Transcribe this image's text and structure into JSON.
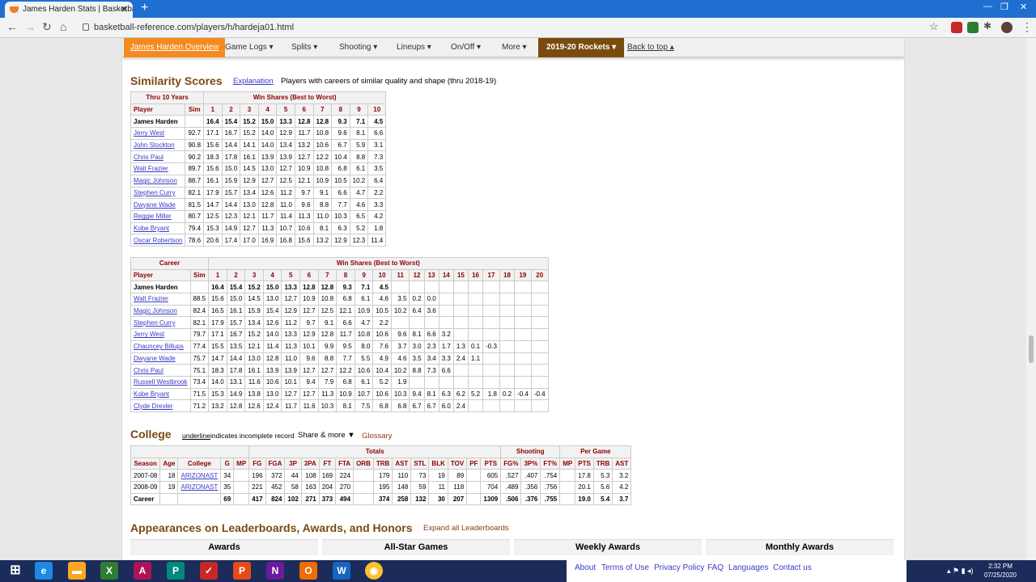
{
  "browser": {
    "tab_title": "James Harden Stats | Basketball-R",
    "url": "basketball-reference.com/players/h/hardeja01.html"
  },
  "navbar": {
    "items": [
      "James Harden Overview",
      "Game Logs ▾",
      "Splits ▾",
      "Shooting ▾",
      "Lineups ▾",
      "On/Off ▾",
      "More ▾",
      "2019-20 Rockets ▾",
      "Back to top ▴"
    ]
  },
  "similarity": {
    "title": "Similarity Scores",
    "explanation": "Explanation",
    "note": "Players with careers of similar quality and shape (thru 2018-19)"
  },
  "thru10": {
    "group1": "Thru 10 Years",
    "group2": "Win Shares (Best to Worst)",
    "headers": [
      "Player",
      "Sim",
      "1",
      "2",
      "3",
      "4",
      "5",
      "6",
      "7",
      "8",
      "9",
      "10"
    ],
    "rows": [
      [
        "James Harden",
        "",
        "16.4",
        "15.4",
        "15.2",
        "15.0",
        "13.3",
        "12.8",
        "12.8",
        "9.3",
        "7.1",
        "4.5"
      ],
      [
        "Jerry West",
        "92.7",
        "17.1",
        "16.7",
        "15.2",
        "14.0",
        "12.9",
        "11.7",
        "10.8",
        "9.6",
        "8.1",
        "6.6"
      ],
      [
        "John Stockton",
        "90.8",
        "15.6",
        "14.4",
        "14.1",
        "14.0",
        "13.4",
        "13.2",
        "10.6",
        "6.7",
        "5.9",
        "3.1"
      ],
      [
        "Chris Paul",
        "90.2",
        "18.3",
        "17.8",
        "16.1",
        "13.9",
        "13.9",
        "12.7",
        "12.2",
        "10.4",
        "8.8",
        "7.3"
      ],
      [
        "Walt Frazier",
        "89.7",
        "15.6",
        "15.0",
        "14.5",
        "13.0",
        "12.7",
        "10.9",
        "10.8",
        "6.8",
        "6.1",
        "3.5"
      ],
      [
        "Magic Johnson",
        "88.7",
        "16.1",
        "15.9",
        "12.9",
        "12.7",
        "12.5",
        "12.1",
        "10.9",
        "10.5",
        "10.2",
        "6.4"
      ],
      [
        "Stephen Curry",
        "82.1",
        "17.9",
        "15.7",
        "13.4",
        "12.6",
        "11.2",
        "9.7",
        "9.1",
        "6.6",
        "4.7",
        "2.2"
      ],
      [
        "Dwyane Wade",
        "81.5",
        "14.7",
        "14.4",
        "13.0",
        "12.8",
        "11.0",
        "9.6",
        "8.8",
        "7.7",
        "4.6",
        "3.3"
      ],
      [
        "Reggie Miller",
        "80.7",
        "12.5",
        "12.3",
        "12.1",
        "11.7",
        "11.4",
        "11.3",
        "11.0",
        "10.3",
        "6.5",
        "4.2"
      ],
      [
        "Kobe Bryant",
        "79.4",
        "15.3",
        "14.9",
        "12.7",
        "11.3",
        "10.7",
        "10.6",
        "8.1",
        "6.3",
        "5.2",
        "1.8"
      ],
      [
        "Oscar Robertson",
        "78.6",
        "20.6",
        "17.4",
        "17.0",
        "16.9",
        "16.8",
        "15.6",
        "13.2",
        "12.9",
        "12.3",
        "11.4"
      ]
    ]
  },
  "career": {
    "group1": "Career",
    "group2": "Win Shares (Best to Worst)",
    "headers": [
      "Player",
      "Sim",
      "1",
      "2",
      "3",
      "4",
      "5",
      "6",
      "7",
      "8",
      "9",
      "10",
      "11",
      "12",
      "13",
      "14",
      "15",
      "16",
      "17",
      "18",
      "19",
      "20"
    ],
    "rows": [
      [
        "James Harden",
        "",
        "16.4",
        "15.4",
        "15.2",
        "15.0",
        "13.3",
        "12.8",
        "12.8",
        "9.3",
        "7.1",
        "4.5",
        "",
        "",
        "",
        "",
        "",
        "",
        "",
        "",
        "",
        ""
      ],
      [
        "Walt Frazier",
        "88.5",
        "15.6",
        "15.0",
        "14.5",
        "13.0",
        "12.7",
        "10.9",
        "10.8",
        "6.8",
        "6.1",
        "4.6",
        "3.5",
        "0.2",
        "0.0",
        "",
        "",
        "",
        "",
        "",
        "",
        ""
      ],
      [
        "Magic Johnson",
        "82.4",
        "16.5",
        "16.1",
        "15.9",
        "15.4",
        "12.9",
        "12.7",
        "12.5",
        "12.1",
        "10.9",
        "10.5",
        "10.2",
        "6.4",
        "3.6",
        "",
        "",
        "",
        "",
        "",
        "",
        ""
      ],
      [
        "Stephen Curry",
        "82.1",
        "17.9",
        "15.7",
        "13.4",
        "12.6",
        "11.2",
        "9.7",
        "9.1",
        "6.6",
        "4.7",
        "2.2",
        "",
        "",
        "",
        "",
        "",
        "",
        "",
        "",
        "",
        ""
      ],
      [
        "Jerry West",
        "79.7",
        "17.1",
        "16.7",
        "15.2",
        "14.0",
        "13.3",
        "12.9",
        "12.8",
        "11.7",
        "10.8",
        "10.6",
        "9.6",
        "8.1",
        "6.6",
        "3.2",
        "",
        "",
        "",
        "",
        "",
        ""
      ],
      [
        "Chauncey Billups",
        "77.4",
        "15.5",
        "13.5",
        "12.1",
        "11.4",
        "11.3",
        "10.1",
        "9.9",
        "9.5",
        "8.0",
        "7.6",
        "3.7",
        "3.0",
        "2.3",
        "1.7",
        "1.3",
        "0.1",
        "-0.3",
        "",
        "",
        ""
      ],
      [
        "Dwyane Wade",
        "75.7",
        "14.7",
        "14.4",
        "13.0",
        "12.8",
        "11.0",
        "9.6",
        "8.8",
        "7.7",
        "5.5",
        "4.9",
        "4.6",
        "3.5",
        "3.4",
        "3.3",
        "2.4",
        "1.1",
        "",
        "",
        "",
        ""
      ],
      [
        "Chris Paul",
        "75.1",
        "18.3",
        "17.8",
        "16.1",
        "13.9",
        "13.9",
        "12.7",
        "12.7",
        "12.2",
        "10.6",
        "10.4",
        "10.2",
        "8.8",
        "7.3",
        "6.6",
        "",
        "",
        "",
        "",
        "",
        ""
      ],
      [
        "Russell Westbrook",
        "73.4",
        "14.0",
        "13.1",
        "11.6",
        "10.6",
        "10.1",
        "9.4",
        "7.9",
        "6.8",
        "6.1",
        "5.2",
        "1.9",
        "",
        "",
        "",
        "",
        "",
        "",
        "",
        "",
        ""
      ],
      [
        "Kobe Bryant",
        "71.5",
        "15.3",
        "14.9",
        "13.8",
        "13.0",
        "12.7",
        "12.7",
        "11.3",
        "10.9",
        "10.7",
        "10.6",
        "10.3",
        "9.4",
        "8.1",
        "6.3",
        "6.2",
        "5.2",
        "1.8",
        "0.2",
        "-0.4",
        "-0.4"
      ],
      [
        "Clyde Drexler",
        "71.2",
        "13.2",
        "12.8",
        "12.6",
        "12.4",
        "11.7",
        "11.6",
        "10.3",
        "8.1",
        "7.5",
        "6.8",
        "6.8",
        "6.7",
        "6.7",
        "6.0",
        "2.4",
        "",
        "",
        "",
        "",
        ""
      ]
    ]
  },
  "college": {
    "title": "College",
    "underline": "underline",
    "underline_note": "indicates incomplete record",
    "share": "Share & more ▼",
    "glossary": "Glossary",
    "groups": [
      "Totals",
      "Shooting",
      "Per Game"
    ],
    "headers": [
      "Season",
      "Age",
      "College",
      "G",
      "MP",
      "FG",
      "FGA",
      "3P",
      "3PA",
      "FT",
      "FTA",
      "ORB",
      "TRB",
      "AST",
      "STL",
      "BLK",
      "TOV",
      "PF",
      "PTS",
      "FG%",
      "3P%",
      "FT%",
      "MP",
      "PTS",
      "TRB",
      "AST"
    ],
    "rows": [
      [
        "2007-08",
        "18",
        "ARIZONAST",
        "34",
        "",
        "196",
        "372",
        "44",
        "108",
        "169",
        "224",
        "",
        "179",
        "110",
        "73",
        "19",
        "89",
        "",
        "605",
        ".527",
        ".407",
        ".754",
        "",
        "17.8",
        "5.3",
        "3.2"
      ],
      [
        "2008-09",
        "19",
        "ARIZONAST",
        "35",
        "",
        "221",
        "452",
        "58",
        "163",
        "204",
        "270",
        "",
        "195",
        "148",
        "59",
        "11",
        "118",
        "",
        "704",
        ".489",
        ".356",
        ".756",
        "",
        "20.1",
        "5.6",
        "4.2"
      ],
      [
        "Career",
        "",
        "",
        "69",
        "",
        "417",
        "824",
        "102",
        "271",
        "373",
        "494",
        "",
        "374",
        "258",
        "132",
        "30",
        "207",
        "",
        "1309",
        ".506",
        ".376",
        ".755",
        "",
        "19.0",
        "5.4",
        "3.7"
      ]
    ]
  },
  "appearances": {
    "title": "Appearances on Leaderboards, Awards, and Honors",
    "expand": "Expand all Leaderboards"
  },
  "awards": [
    "Awards",
    "All-Star Games",
    "Weekly Awards",
    "Monthly Awards"
  ],
  "footer": [
    "About",
    "Terms of Use",
    "Privacy Policy",
    "FAQ",
    "Languages",
    "Contact us"
  ],
  "clock": {
    "time": "2:32 PM",
    "date": "07/25/2020"
  },
  "colors": {
    "accent": "#7a4b0f",
    "orange": "#f58b1f",
    "link": "#3a3ac8",
    "header_red": "#8b0000"
  }
}
